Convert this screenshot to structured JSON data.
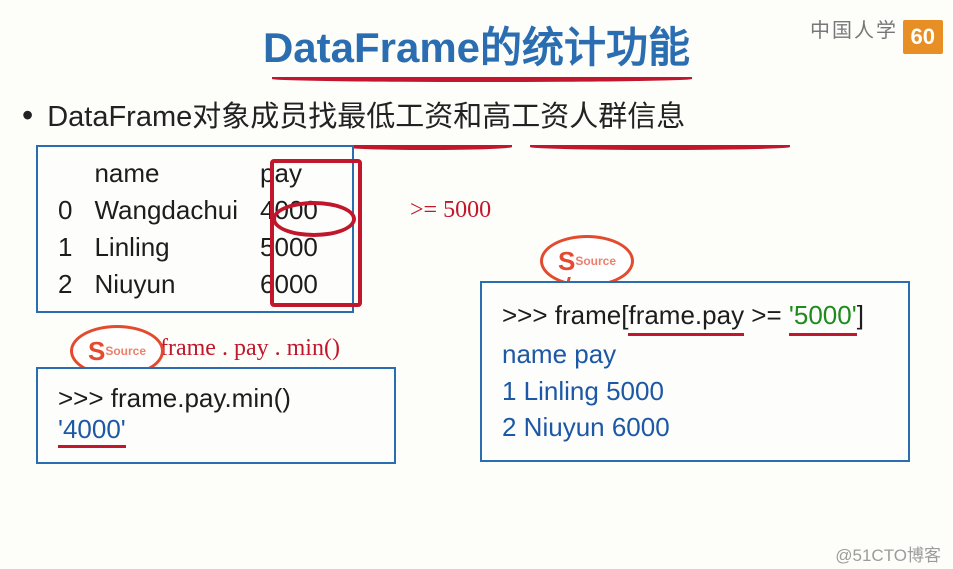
{
  "page_number": "60",
  "watermark_top": "中国人学",
  "watermark_bottom": "@51CTO博客",
  "title": "DataFrame的统计功能",
  "bullet": "DataFrame对象成员找最低工资和高工资人群信息",
  "source_label": "Source",
  "table": {
    "columns": [
      "",
      "name",
      "pay"
    ],
    "rows": [
      [
        "0",
        "Wangdachui",
        "4000"
      ],
      [
        "1",
        "Linling",
        "5000"
      ],
      [
        "2",
        "Niuyun",
        "6000"
      ]
    ]
  },
  "annotations": {
    "ge5000": ">= 5000",
    "frame_pay_min": "frame . pay . min()"
  },
  "left_code": {
    "line1_prompt": ">>> ",
    "line1_code": "frame.pay.min()",
    "line2_result": "'4000'"
  },
  "right_code": {
    "line1_prompt": ">>> ",
    "line1_a": "frame[",
    "line1_b": "frame.pay",
    "line1_c": " >= ",
    "line1_d": "'5000'",
    "line1_e": "]",
    "line2": "name   pay",
    "line3": "1  Linling  5000",
    "line4": "2  Niuyun  6000"
  },
  "chart_data": {
    "type": "table",
    "columns": [
      "name",
      "pay"
    ],
    "rows": [
      {
        "index": 0,
        "name": "Wangdachui",
        "pay": 4000
      },
      {
        "index": 1,
        "name": "Linling",
        "pay": 5000
      },
      {
        "index": 2,
        "name": "Niuyun",
        "pay": 6000
      }
    ],
    "operations": [
      {
        "expr": "frame.pay.min()",
        "result": "4000"
      },
      {
        "expr": "frame[frame.pay >= '5000']",
        "result_rows": [
          {
            "index": 1,
            "name": "Linling",
            "pay": 5000
          },
          {
            "index": 2,
            "name": "Niuyun",
            "pay": 6000
          }
        ]
      }
    ]
  }
}
